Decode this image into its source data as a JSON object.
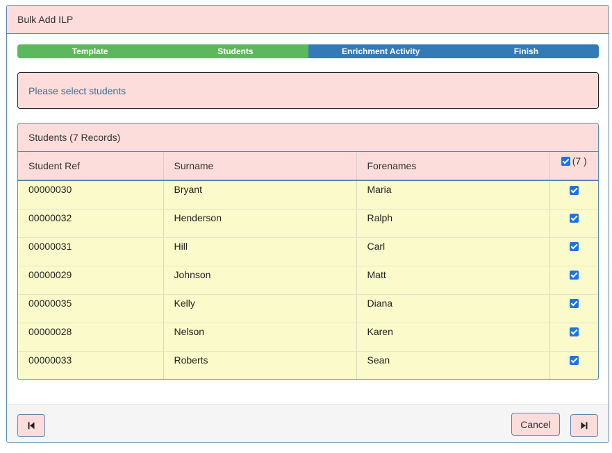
{
  "dialog": {
    "title": "Bulk Add ILP"
  },
  "wizard": {
    "steps": [
      {
        "label": "Template",
        "state": "done"
      },
      {
        "label": "Students",
        "state": "done"
      },
      {
        "label": "Enrichment Activity",
        "state": "todo"
      },
      {
        "label": "Finish",
        "state": "todo"
      }
    ],
    "colors": {
      "done": "#5cb85c",
      "todo": "#337ab7"
    }
  },
  "alert": {
    "message": "Please select students"
  },
  "panel": {
    "title": "Students (7 Records)",
    "columns": {
      "ref": "Student Ref",
      "surname": "Surname",
      "forenames": "Forenames",
      "select_count": "(7 )"
    },
    "rows": [
      {
        "ref": "00000030",
        "surname": "Bryant",
        "forenames": "Maria",
        "selected": true
      },
      {
        "ref": "00000032",
        "surname": "Henderson",
        "forenames": "Ralph",
        "selected": true
      },
      {
        "ref": "00000031",
        "surname": "Hill",
        "forenames": "Carl",
        "selected": true
      },
      {
        "ref": "00000029",
        "surname": "Johnson",
        "forenames": "Matt",
        "selected": true
      },
      {
        "ref": "00000035",
        "surname": "Kelly",
        "forenames": "Diana",
        "selected": true
      },
      {
        "ref": "00000028",
        "surname": "Nelson",
        "forenames": "Karen",
        "selected": true
      },
      {
        "ref": "00000033",
        "surname": "Roberts",
        "forenames": "Sean",
        "selected": true
      }
    ]
  },
  "footer": {
    "first_icon": "skip-to-first-icon",
    "cancel_label": "Cancel",
    "next_icon": "skip-to-next-icon"
  },
  "theme": {
    "accent": "#fddddb",
    "border": "#5a86b4",
    "row_bg": "#fafaca",
    "alert_text": "#31708f"
  }
}
